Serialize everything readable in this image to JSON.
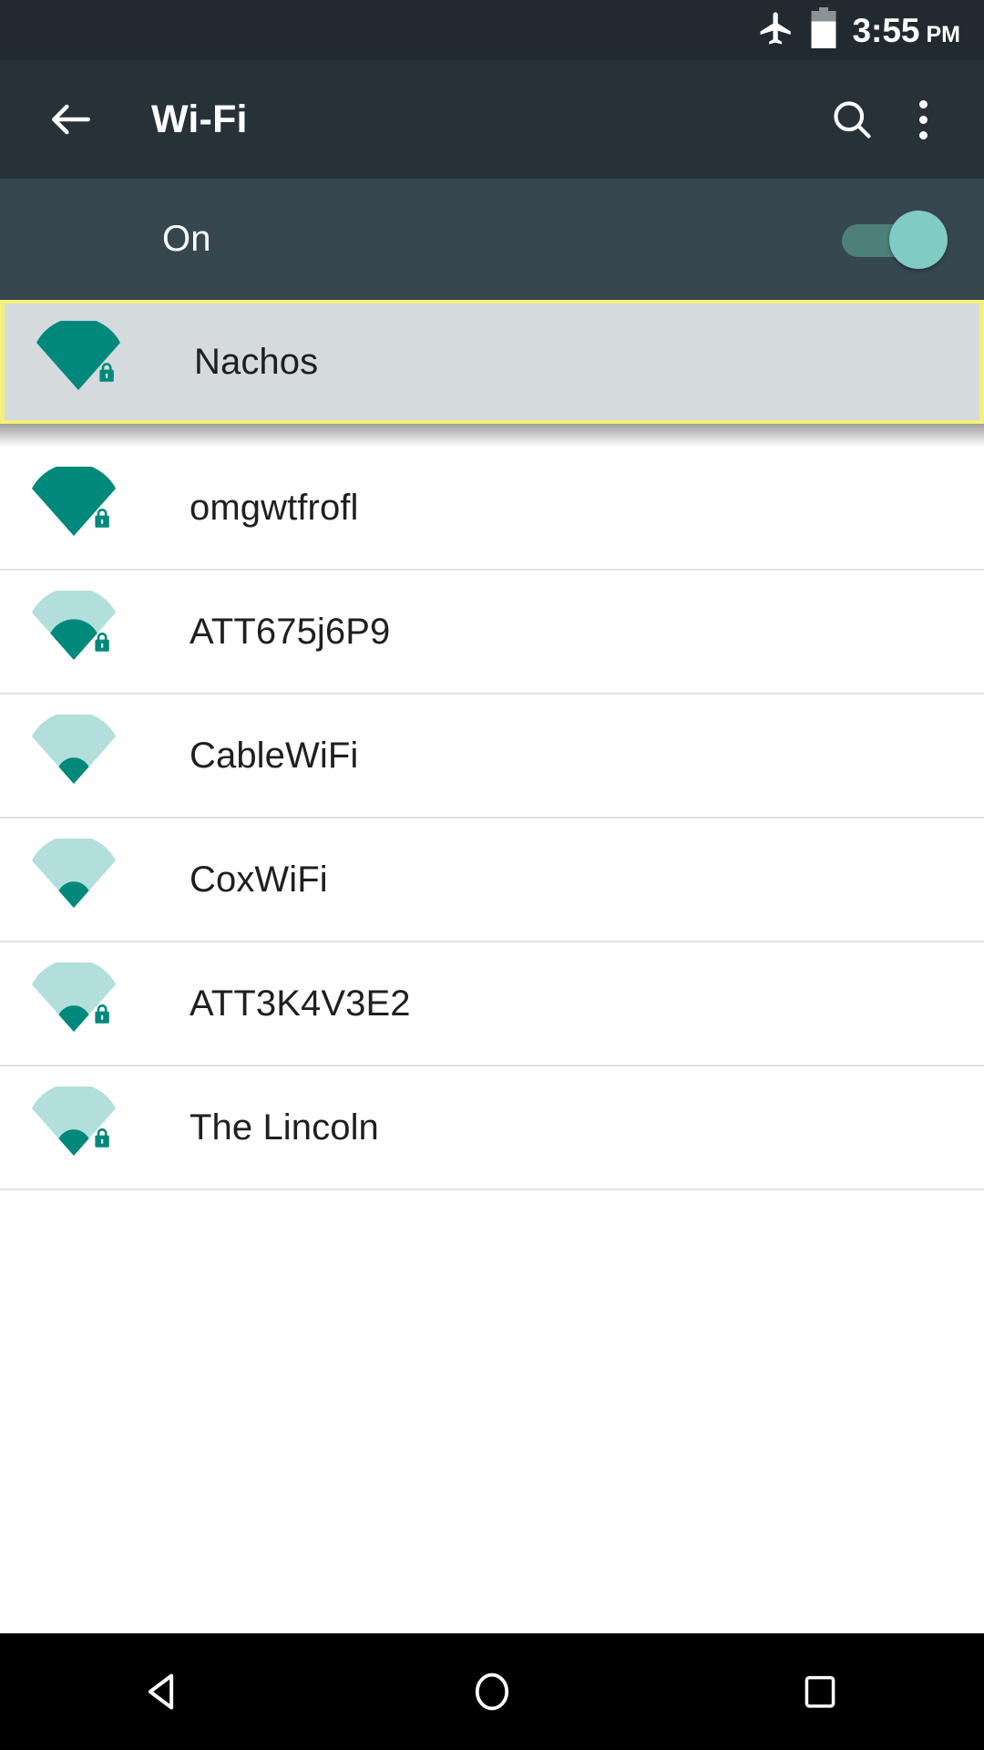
{
  "status_bar": {
    "airplane_icon": "airplane-mode-icon",
    "battery_icon": "battery-icon",
    "battery_level_percent": 72,
    "time": "3:55",
    "ampm": "PM",
    "background_color": "#212a2f",
    "text_color": "#ffffff"
  },
  "toolbar": {
    "back_icon": "back-arrow-icon",
    "title": "Wi-Fi",
    "search_icon": "search-icon",
    "overflow_icon": "overflow-menu-icon",
    "background_color": "#263238",
    "text_color": "#ffffff"
  },
  "wifi_switch": {
    "label": "On",
    "state": "on",
    "track_color": "#4d8079",
    "thumb_color": "#80cbc4",
    "row_background": "#37474f"
  },
  "networks": {
    "highlight_border_color": "#f4f07a",
    "selected_row_background": "#d5dadd",
    "icon_color_strong": "#00897b",
    "icon_color_faded": "#b2dfdb",
    "items": [
      {
        "ssid": "Nachos",
        "signal": 4,
        "secured": true,
        "selected": true,
        "icon": "wifi-signal-lock-icon"
      },
      {
        "ssid": "omgwtfrofl",
        "signal": 4,
        "secured": true,
        "selected": false,
        "icon": "wifi-signal-lock-icon"
      },
      {
        "ssid": "ATT675j6P9",
        "signal": 2,
        "secured": true,
        "selected": false,
        "icon": "wifi-signal-lock-icon"
      },
      {
        "ssid": "CableWiFi",
        "signal": 1,
        "secured": false,
        "selected": false,
        "icon": "wifi-signal-icon"
      },
      {
        "ssid": "CoxWiFi",
        "signal": 1,
        "secured": false,
        "selected": false,
        "icon": "wifi-signal-icon"
      },
      {
        "ssid": "ATT3K4V3E2",
        "signal": 1,
        "secured": true,
        "selected": false,
        "icon": "wifi-signal-lock-icon"
      },
      {
        "ssid": "The Lincoln",
        "signal": 1,
        "secured": true,
        "selected": false,
        "icon": "wifi-signal-lock-icon"
      }
    ]
  },
  "nav_bar": {
    "background_color": "#000000",
    "back_icon": "nav-back-triangle-icon",
    "home_icon": "nav-home-circle-icon",
    "recents_icon": "nav-recents-square-icon"
  }
}
